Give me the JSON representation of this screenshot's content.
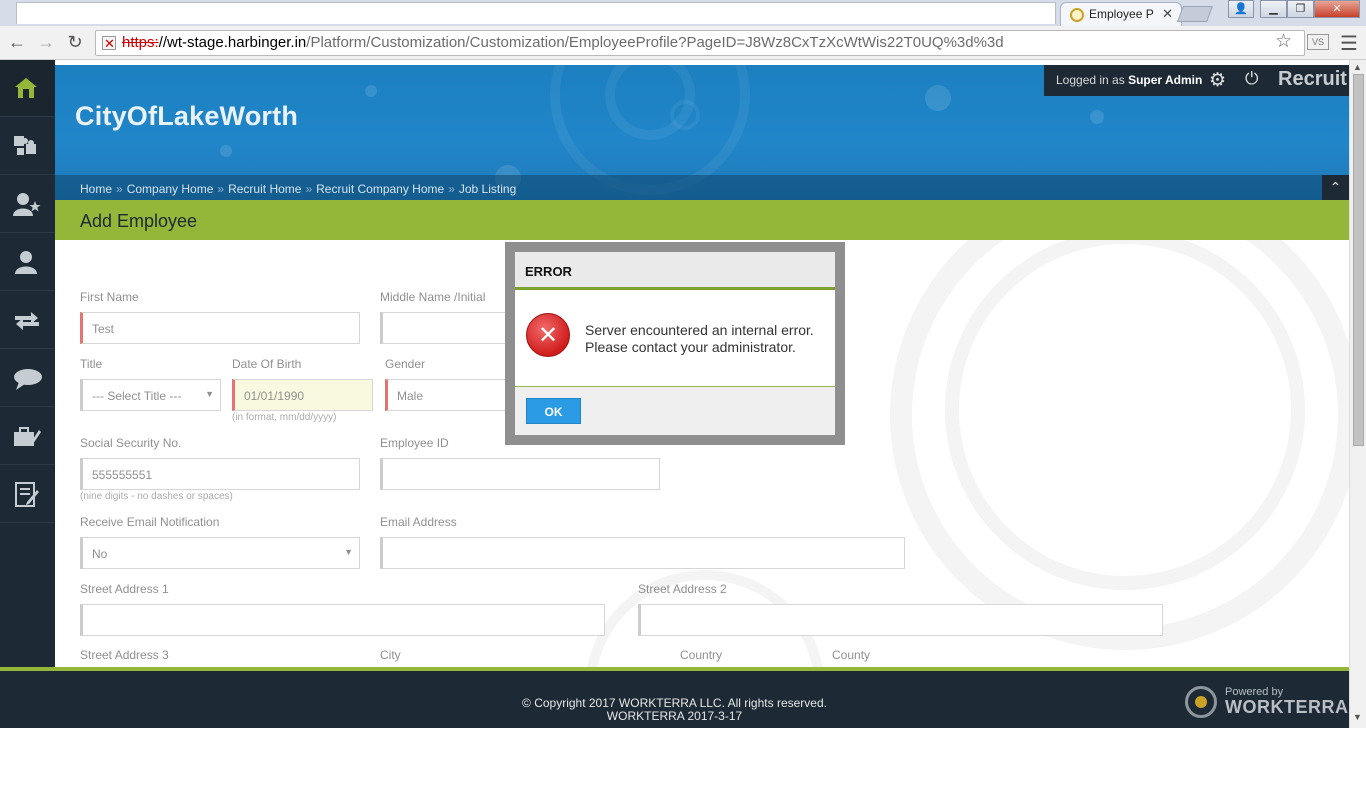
{
  "browser": {
    "tab_title": "Employee P",
    "url_scheme": "https:",
    "url_host": "//wt-stage.harbinger.in",
    "url_path": "/Platform/Customization/Customization/EmployeeProfile?PageID=J8Wz8CxTzXcWtWis22T0UQ%3d%3d",
    "extension_label": "VS"
  },
  "header": {
    "brand": "CityOfLakeWorth",
    "logged_in_prefix": "Logged in as",
    "logged_in_user": "Super Admin",
    "app_name": "Recruit"
  },
  "breadcrumb": [
    "Home",
    "Company Home",
    "Recruit Home",
    "Recruit Company Home",
    "Job Listing"
  ],
  "page_title": "Add Employee",
  "form": {
    "first_name_label": "First Name",
    "first_name_value": "Test",
    "middle_name_label": "Middle Name /Initial",
    "title_label": "Title",
    "title_value": "--- Select Title ---",
    "dob_label": "Date Of Birth",
    "dob_value": "01/01/1990",
    "dob_hint": "(in format, mm/dd/yyyy)",
    "gender_label": "Gender",
    "gender_value": "Male",
    "ssn_label": "Social Security No.",
    "ssn_value": "555555551",
    "ssn_hint": "(nine digits - no dashes or spaces)",
    "employee_id_label": "Employee ID",
    "email_notify_label": "Receive Email Notification",
    "email_notify_value": "No",
    "email_label": "Email Address",
    "street1_label": "Street Address 1",
    "street2_label": "Street Address 2",
    "street3_label": "Street Address 3",
    "city_label": "City",
    "country_label": "Country",
    "county_label": "County"
  },
  "dialog": {
    "title": "ERROR",
    "message_line1": "Server encountered an internal error.",
    "message_line2": "Please contact your administrator.",
    "ok_label": "OK"
  },
  "footer": {
    "copyright": "© Copyright 2017 WORKTERRA LLC. All rights reserved.",
    "version": "WORKTERRA 2017-3-17",
    "powered_by": "Powered by",
    "powered_brand": "WORKTERRA"
  },
  "colors": {
    "header_blue": "#2186c9",
    "accent_green": "#94b73a",
    "sidebar_dark": "#1d2a35",
    "required_red": "#d00000",
    "ok_button_blue": "#2a9be4"
  }
}
